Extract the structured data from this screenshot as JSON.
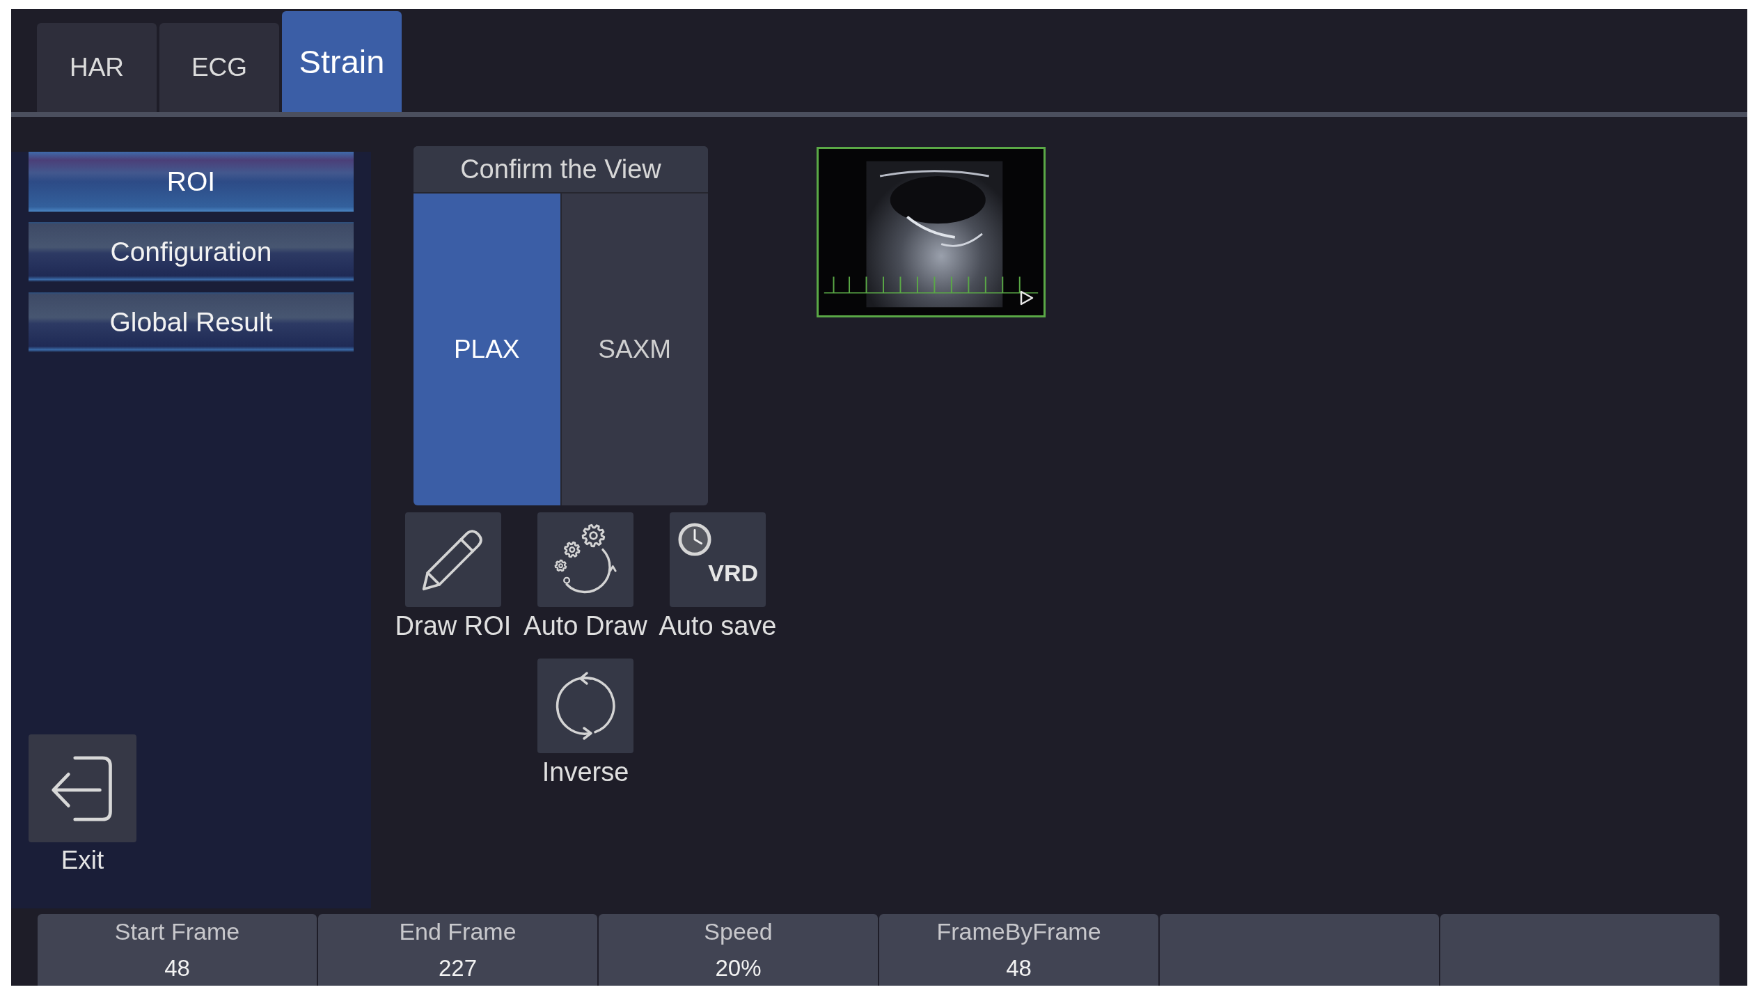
{
  "tabs": [
    {
      "label": "HAR",
      "selected": false
    },
    {
      "label": "ECG",
      "selected": false
    },
    {
      "label": "Strain",
      "selected": true
    }
  ],
  "sidebar": {
    "items": [
      {
        "label": "ROI",
        "selected": true
      },
      {
        "label": "Configuration",
        "selected": false
      },
      {
        "label": "Global Result",
        "selected": false
      }
    ],
    "exit": {
      "label": "Exit"
    }
  },
  "view_panel": {
    "title": "Confirm the View",
    "options": [
      {
        "label": "PLAX",
        "selected": true
      },
      {
        "label": "SAXM",
        "selected": false
      }
    ]
  },
  "tool_rows": [
    {
      "tools": [
        {
          "kind": "pencil",
          "label": "Draw ROI"
        },
        {
          "kind": "gears",
          "label": "Auto Draw"
        },
        {
          "kind": "timer",
          "label": "Auto save",
          "icon_text": "VRD"
        }
      ]
    },
    {
      "tools": [
        {
          "kind": "cycle",
          "label": "Inverse"
        }
      ]
    }
  ],
  "clip": {
    "selected": true
  },
  "bottom_bar": {
    "items": [
      {
        "kind": "param",
        "label": "Start Frame",
        "value": "48"
      },
      {
        "kind": "param",
        "label": "End Frame",
        "value": "227"
      },
      {
        "kind": "param",
        "label": "Speed",
        "value": "20%"
      },
      {
        "kind": "param",
        "label": "FrameByFrame",
        "value": "48"
      },
      {
        "kind": "blank"
      },
      {
        "kind": "blank"
      }
    ]
  }
}
